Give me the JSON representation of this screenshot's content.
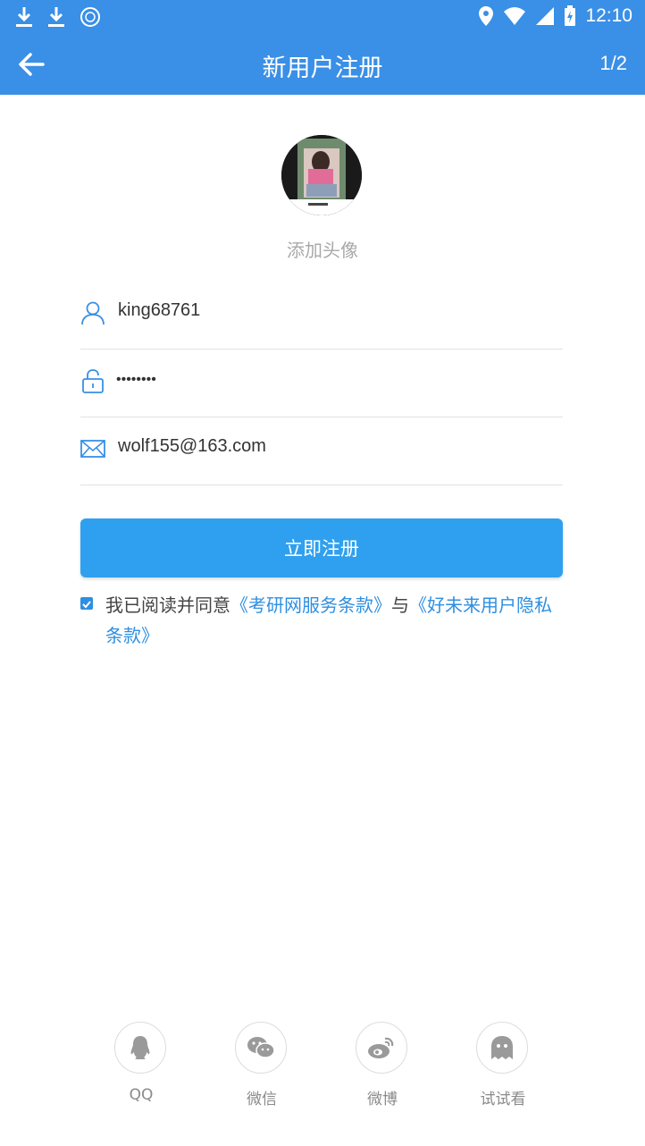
{
  "status_bar": {
    "time": "12:10",
    "icons": [
      "download-icon",
      "download-icon",
      "nox-icon",
      "location-icon",
      "wifi-icon",
      "signal-icon",
      "battery-icon"
    ]
  },
  "header": {
    "title": "新用户注册",
    "step": "1/2"
  },
  "avatar": {
    "label": "添加头像"
  },
  "form": {
    "username": "king68761",
    "password": "••••••••",
    "email": "wolf155@163.com"
  },
  "register_button": "立即注册",
  "agreement": {
    "text": "我已阅读并同意",
    "link1": "《考研网服务条款》",
    "connector": "与",
    "link2": "《好未来用户隐私条款》"
  },
  "social": [
    {
      "label": "QQ",
      "icon": "qq-icon"
    },
    {
      "label": "微信",
      "icon": "wechat-icon"
    },
    {
      "label": "微博",
      "icon": "weibo-icon"
    },
    {
      "label": "试试看",
      "icon": "ghost-icon"
    }
  ],
  "colors": {
    "primary": "#3a8fe6",
    "button": "#2fa0ef",
    "link": "#2f8fe0"
  }
}
